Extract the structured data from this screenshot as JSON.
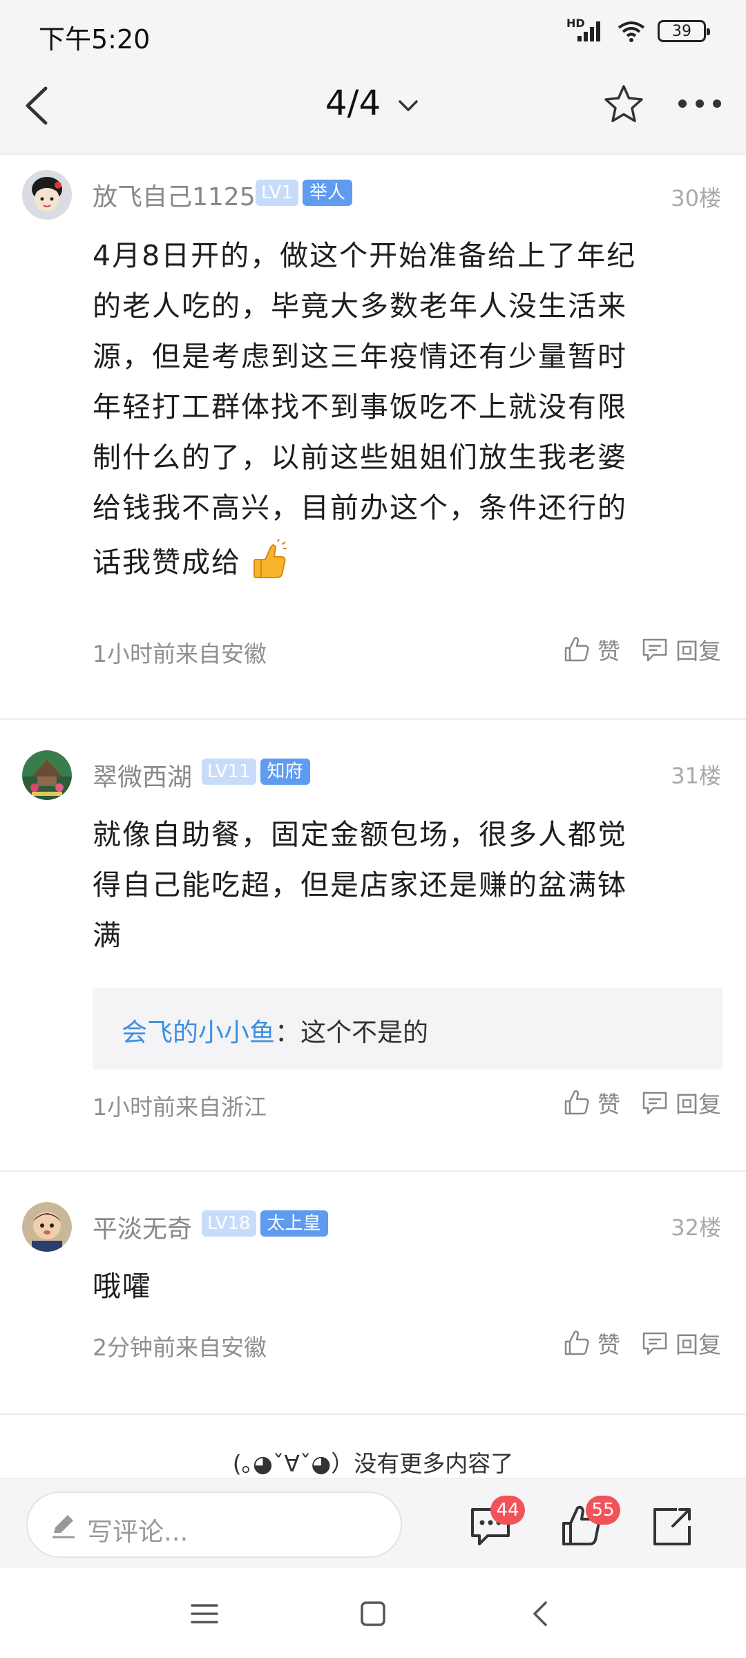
{
  "status_bar": {
    "time": "下午5:20",
    "network_label": "HD",
    "battery": "39"
  },
  "nav": {
    "page_indicator": "4/4",
    "icons": [
      "back-arrow-icon",
      "chevron-down-icon",
      "star-icon",
      "more-icon"
    ]
  },
  "comments": [
    {
      "username": "放飞自己1125",
      "level": "LV1",
      "title": "举人",
      "floor": "30楼",
      "content_lines": [
        "4月8日开的，做这个开始准备给上了年纪",
        "的老人吃的，毕竟大多数老年人没生活来",
        "源，但是考虑到这三年疫情还有少量暂时",
        "年轻打工群体找不到事饭吃不上就没有限",
        "制什么的了，以前这些姐姐们放生我老婆",
        "给钱我不高兴，目前办这个，条件还行的",
        "话我赞成给"
      ],
      "meta": "1小时前来自安徽",
      "like_label": "赞",
      "reply_label": "回复"
    },
    {
      "username": "翠微西湖",
      "level": "LV11",
      "title": "知府",
      "floor": "31楼",
      "content_lines": [
        "就像自助餐，固定金额包场，很多人都觉",
        "得自己能吃超，但是店家还是赚的盆满钵",
        "满"
      ],
      "reply": {
        "user": "会飞的小小鱼",
        "separator": "：",
        "text": "这个不是的"
      },
      "meta": "1小时前来自浙江",
      "like_label": "赞",
      "reply_label": "回复"
    },
    {
      "username": "平淡无奇",
      "level": "LV18",
      "title": "太上皇",
      "floor": "32楼",
      "content_lines": [
        "哦嚯"
      ],
      "meta": "2分钟前来自安徽",
      "like_label": "赞",
      "reply_label": "回复"
    }
  ],
  "end_message": "(｡◕ˇ∀ˇ◕）没有更多内容了",
  "bottom_bar": {
    "comment_placeholder": "写评论...",
    "comment_count": "44",
    "like_count": "55"
  },
  "colors": {
    "accent_blue": "#5f9bef",
    "level_badge": "#c7dcfa",
    "reply_user": "#3e8fe0",
    "count_badge_red": "#f05358"
  }
}
